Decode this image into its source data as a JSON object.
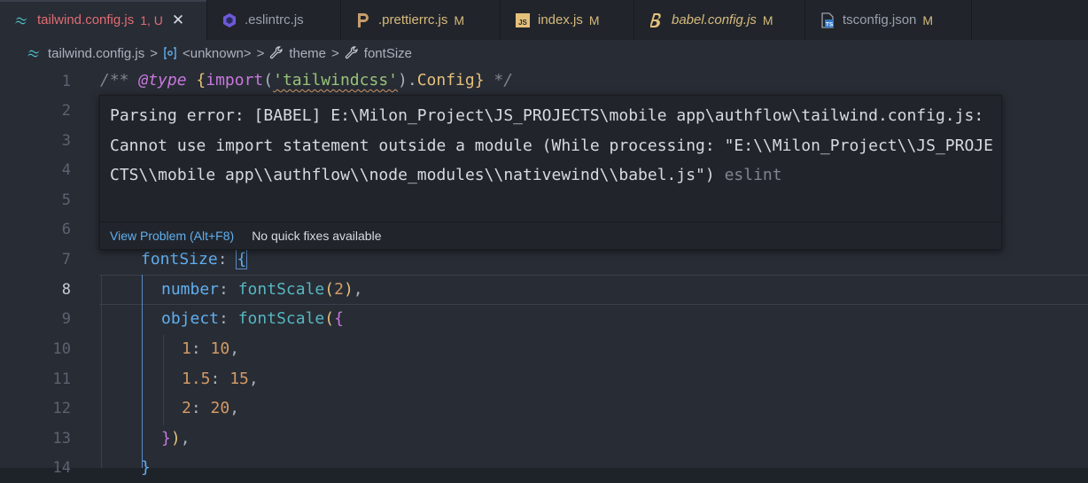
{
  "tabs": [
    {
      "name": "tailwind.config.js",
      "status": "1, U",
      "icon": "tailwind-icon",
      "active": true,
      "close": "✕"
    },
    {
      "name": ".eslintrc.js",
      "status": "",
      "icon": "eslint-icon"
    },
    {
      "name": ".prettierrc.js",
      "status": "M",
      "icon": "prettier-icon"
    },
    {
      "name": "index.js",
      "status": "M",
      "icon": "js-file-icon"
    },
    {
      "name": "babel.config.js",
      "status": "M",
      "icon": "babel-icon"
    },
    {
      "name": "tsconfig.json",
      "status": "M",
      "icon": "ts-file-icon"
    }
  ],
  "breadcrumb": {
    "file": "tailwind.config.js",
    "unknown": "<unknown>",
    "theme": "theme",
    "fontSize": "fontSize",
    "sep": ">"
  },
  "gutter": {
    "lines": [
      "1",
      "2",
      "3",
      "4",
      "5",
      "6",
      "7",
      "8",
      "9",
      "10",
      "11",
      "12",
      "13",
      "14"
    ],
    "current": "8"
  },
  "code": {
    "l1": {
      "a": "/** ",
      "b": "@type",
      "c": " ",
      "d": "{",
      "e": "import",
      "f": "(",
      "g": "'tailwindcss'",
      "h": ")",
      "i": ".",
      "j": "Config",
      "k": "}",
      "l": " */"
    },
    "l7": {
      "a": "fontSize",
      "b": ": ",
      "c": "{"
    },
    "l8": {
      "a": "number",
      "b": ": ",
      "c": "fontScale",
      "d": "(",
      "e": "2",
      "f": ")",
      "g": ","
    },
    "l9": {
      "a": "object",
      "b": ": ",
      "c": "fontScale",
      "d": "(",
      "e": "{"
    },
    "l10": {
      "a": "1",
      "b": ": ",
      "c": "10",
      "d": ","
    },
    "l11": {
      "a": "1.5",
      "b": ": ",
      "c": "15",
      "d": ","
    },
    "l12": {
      "a": "2",
      "b": ": ",
      "c": "20",
      "d": ","
    },
    "l13": {
      "a": "}",
      "b": ")",
      "c": ","
    },
    "l14": {
      "a": "}"
    }
  },
  "hover": {
    "message": "Parsing error: [BABEL] E:\\Milon_Project\\JS_PROJECTS\\mobile app\\authflow\\tailwind.config.js: Cannot use import statement outside a module (While processing: \"E:\\\\Milon_Project\\\\JS_PROJECTS\\\\mobile app\\\\authflow\\\\node_modules\\\\nativewind\\\\babel.js\")",
    "source": "eslint",
    "view_problem": "View Problem (Alt+F8)",
    "no_fixes": "No quick fixes available"
  },
  "colors": {
    "accent_error": "#e06c75",
    "modified": "#d7ba7d",
    "link": "#61afef"
  }
}
